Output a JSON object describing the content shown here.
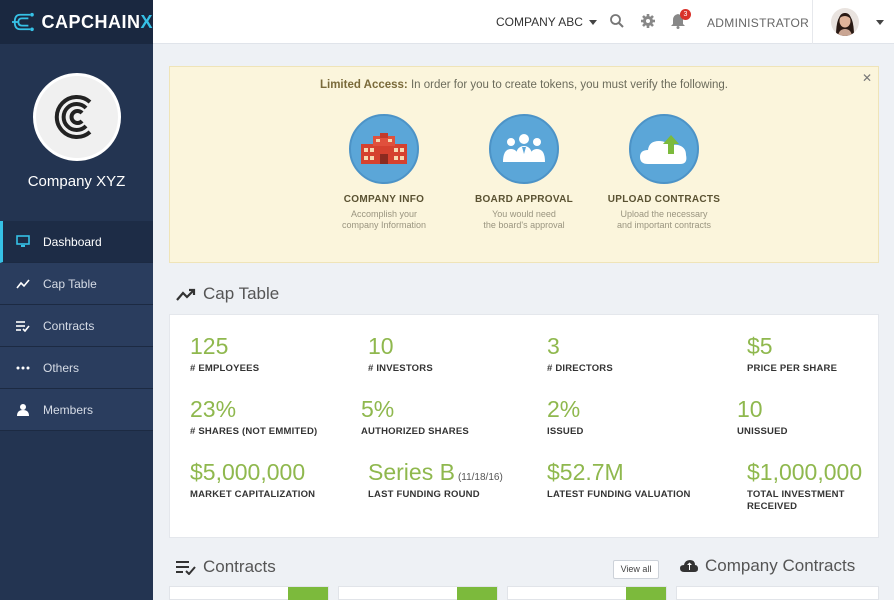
{
  "brand": {
    "name_main": "CAPCHAIN",
    "name_accent": "X"
  },
  "sidebar": {
    "company": "Company XYZ",
    "items": [
      {
        "label": "Dashboard",
        "icon": "monitor-icon",
        "active": true
      },
      {
        "label": "Cap Table",
        "icon": "trend-icon",
        "active": false
      },
      {
        "label": "Contracts",
        "icon": "checklist-icon",
        "active": false
      },
      {
        "label": "Others",
        "icon": "dots-icon",
        "active": false
      },
      {
        "label": "Members",
        "icon": "user-icon",
        "active": false
      }
    ]
  },
  "topbar": {
    "company": "COMPANY ABC",
    "notifications": "3",
    "user": "ADMINISTRATOR"
  },
  "alert": {
    "lead": "Limited Access:",
    "text": " In order for you to create tokens, you must verify  the following.",
    "steps": [
      {
        "title": "COMPANY INFO",
        "desc1": "Accomplish your",
        "desc2": "company Information"
      },
      {
        "title": "BOARD APPROVAL",
        "desc1": "You would need",
        "desc2": "the board's approval"
      },
      {
        "title": "UPLOAD CONTRACTS",
        "desc1": "Upload the necessary",
        "desc2": "and important contracts"
      }
    ]
  },
  "cap_table": {
    "title": "Cap Table",
    "metrics": [
      {
        "value": "125",
        "label": "# EMPLOYEES"
      },
      {
        "value": "10",
        "label": "# INVESTORS"
      },
      {
        "value": "3",
        "label": "# DIRECTORS"
      },
      {
        "value": "$5",
        "label": "PRICE PER SHARE"
      },
      {
        "value": "23%",
        "label": "# SHARES (NOT EMMITED)"
      },
      {
        "value": "5%",
        "label": "AUTHORIZED SHARES"
      },
      {
        "value": "2%",
        "label": "ISSUED"
      },
      {
        "value": "10",
        "label": "UNISSUED"
      },
      {
        "value": "$5,000,000",
        "label": "MARKET CAPITALIZATION"
      },
      {
        "value": "Series B",
        "note": "(11/18/16)",
        "label": "LAST FUNDING ROUND"
      },
      {
        "value": "$52.7M",
        "label": "LATEST FUNDING VALUATION"
      },
      {
        "value": "$1,000,000",
        "label": "TOTAL INVESTMENT",
        "label2": "RECEIVED"
      }
    ]
  },
  "contracts": {
    "title": "Contracts",
    "view_all": "View all"
  },
  "company_contracts": {
    "title": "Company Contracts"
  },
  "colors": {
    "accent": "#36c1e6",
    "metric": "#8fb84e",
    "sidebar": "#233451",
    "step": "#5ba6d8"
  }
}
